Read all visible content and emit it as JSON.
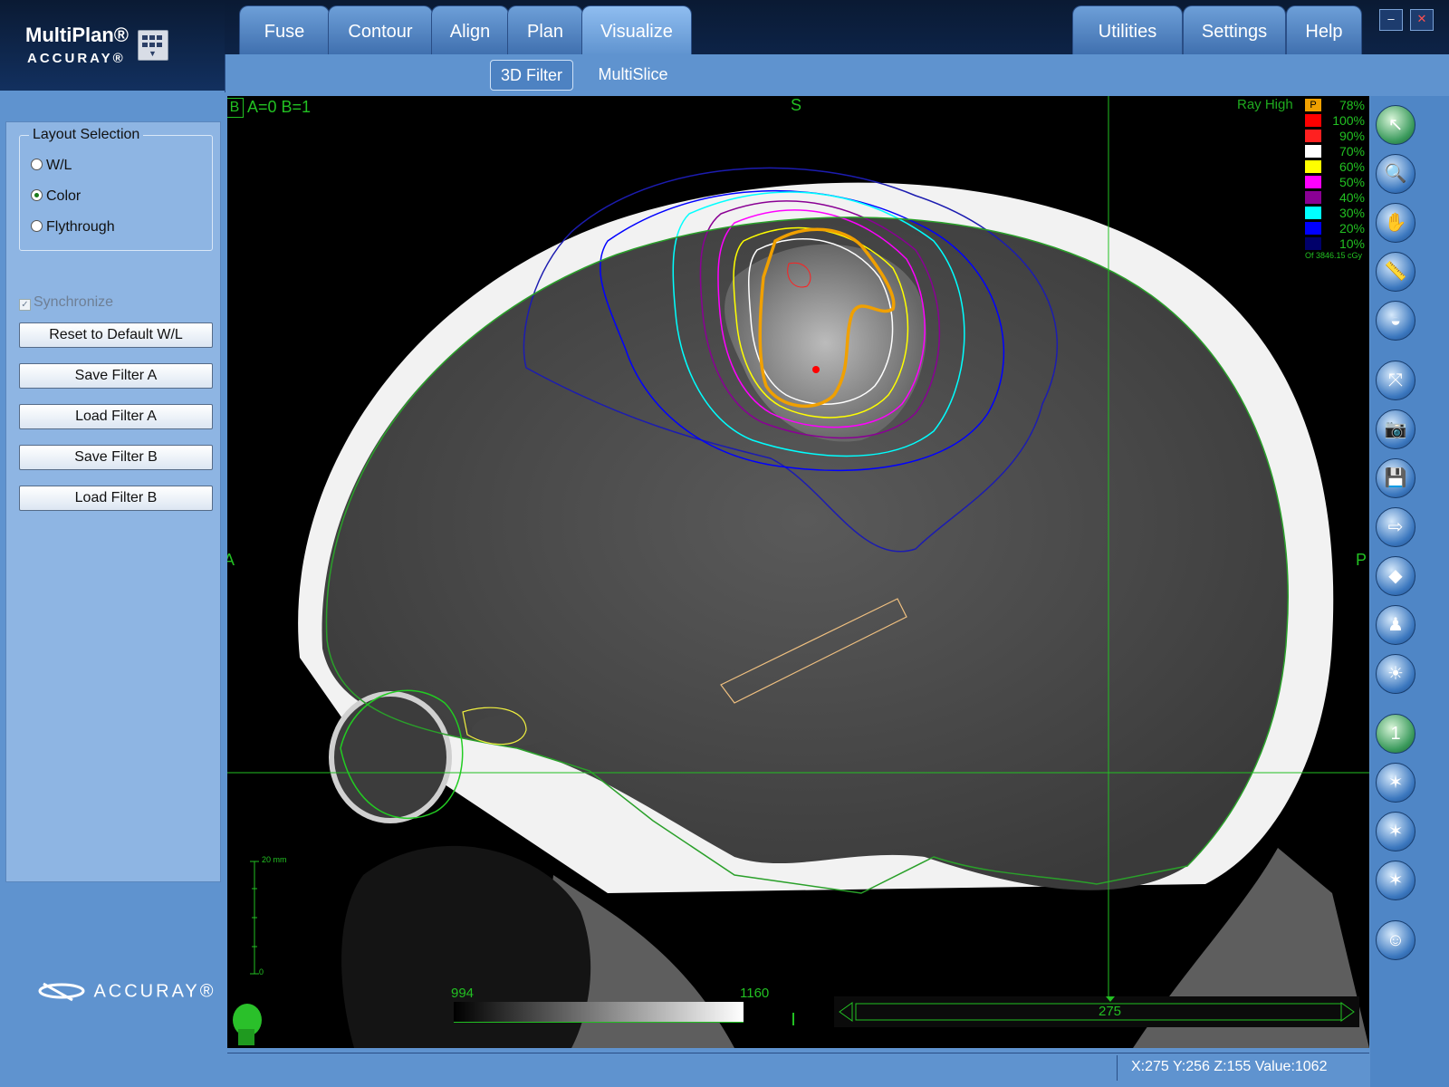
{
  "brand": {
    "product": "MultiPlan®",
    "company": "ACCURAY®",
    "footer_logo": "ACCURAY®"
  },
  "tabs": [
    {
      "label": "Fuse",
      "active": false
    },
    {
      "label": "Contour",
      "active": false
    },
    {
      "label": "Align",
      "active": false
    },
    {
      "label": "Plan",
      "active": false
    },
    {
      "label": "Visualize",
      "active": true
    }
  ],
  "right_tabs": [
    "Utilities",
    "Settings",
    "Help"
  ],
  "subtabs": [
    {
      "label": "3D Filter",
      "active": true
    },
    {
      "label": "MultiSlice",
      "active": false
    }
  ],
  "window_controls": {
    "minimize": "–",
    "close": "✕"
  },
  "left_panel": {
    "layout_selection": {
      "title": "Layout Selection",
      "options": [
        {
          "label": "W/L",
          "selected": false
        },
        {
          "label": "Color",
          "selected": true
        },
        {
          "label": "Flythrough",
          "selected": false
        }
      ]
    },
    "synchronize": {
      "label": "Synchronize",
      "checked": true,
      "enabled": false
    },
    "buttons": [
      "Reset to Default W/L",
      "Save Filter A",
      "Load Filter A",
      "Save Filter B",
      "Load Filter B"
    ]
  },
  "viewer": {
    "filter_label": "B",
    "filter_values": "A=0 B=1",
    "orient_top": "S",
    "orient_left": "A",
    "orient_right": "P",
    "ray_label": "Ray High",
    "dose_legend": [
      {
        "swatch": "P",
        "label": "78%",
        "color": "#f0a000"
      },
      {
        "label": "100%",
        "color": "#ff0000"
      },
      {
        "label": "90%",
        "color": "#ff2020"
      },
      {
        "label": "70%",
        "color": "#ffffff"
      },
      {
        "label": "60%",
        "color": "#ffff00"
      },
      {
        "label": "50%",
        "color": "#ff00ff"
      },
      {
        "label": "40%",
        "color": "#8a0094"
      },
      {
        "label": "30%",
        "color": "#00ffff"
      },
      {
        "label": "20%",
        "color": "#0000ff"
      },
      {
        "label": "10%",
        "color": "#00006a"
      }
    ],
    "dose_reference": "Of 3846.15 cGy",
    "scale_label": "20 mm",
    "scale_zero": "0",
    "wl_min": "994",
    "wl_max": "1160",
    "slice_value": "275"
  },
  "tools": [
    {
      "name": "select-arrow-icon",
      "glyph": "↖",
      "green": true
    },
    {
      "name": "zoom-icon",
      "glyph": "🔍",
      "green": false
    },
    {
      "name": "pan-hand-icon",
      "glyph": "✋",
      "green": false
    },
    {
      "name": "ruler-icon",
      "glyph": "📏",
      "green": false
    },
    {
      "name": "window-level-icon",
      "glyph": "◒",
      "green": false
    },
    {
      "name": "fit-view-icon",
      "glyph": "⤧",
      "green": false
    },
    {
      "name": "camera-icon",
      "glyph": "📷",
      "green": false
    },
    {
      "name": "save-icon",
      "glyph": "💾",
      "green": false
    },
    {
      "name": "export-icon",
      "glyph": "⇨",
      "green": false
    },
    {
      "name": "eraser-icon",
      "glyph": "◆",
      "green": false
    },
    {
      "name": "patient-icon",
      "glyph": "♟",
      "green": false
    },
    {
      "name": "light-icon",
      "glyph": "☀",
      "green": false
    },
    {
      "name": "beam-1-icon",
      "glyph": "1",
      "green": true
    },
    {
      "name": "beam-2-icon",
      "glyph": "✶",
      "green": false
    },
    {
      "name": "beam-3-icon",
      "glyph": "✶",
      "green": false
    },
    {
      "name": "beam-4-icon",
      "glyph": "✶",
      "green": false
    },
    {
      "name": "user-icon",
      "glyph": "☺",
      "green": false
    }
  ],
  "status": {
    "coordinates": "X:275 Y:256 Z:155  Value:1062"
  }
}
